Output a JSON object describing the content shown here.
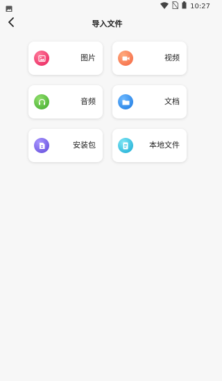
{
  "status_bar": {
    "time": "10:27",
    "icons": [
      "image-notification-icon",
      "wifi-icon",
      "no-sim-icon",
      "battery-icon"
    ]
  },
  "nav": {
    "title": "导入文件",
    "back_icon": "back-arrow-icon"
  },
  "categories": [
    {
      "label": "图片",
      "icon": "image-icon",
      "color": "#f0406e"
    },
    {
      "label": "视频",
      "icon": "video-icon",
      "color": "#fb7a52"
    },
    {
      "label": "音频",
      "icon": "headphones-icon",
      "color": "#5cbd3e"
    },
    {
      "label": "文档",
      "icon": "folder-icon",
      "color": "#2b8ff0"
    },
    {
      "label": "安装包",
      "icon": "package-icon",
      "color": "#7a63ea"
    },
    {
      "label": "本地文件",
      "icon": "document-icon",
      "color": "#2fc3e0"
    }
  ],
  "colors": {
    "background": "#f7f7f7",
    "card": "#ffffff",
    "text": "#222222"
  }
}
